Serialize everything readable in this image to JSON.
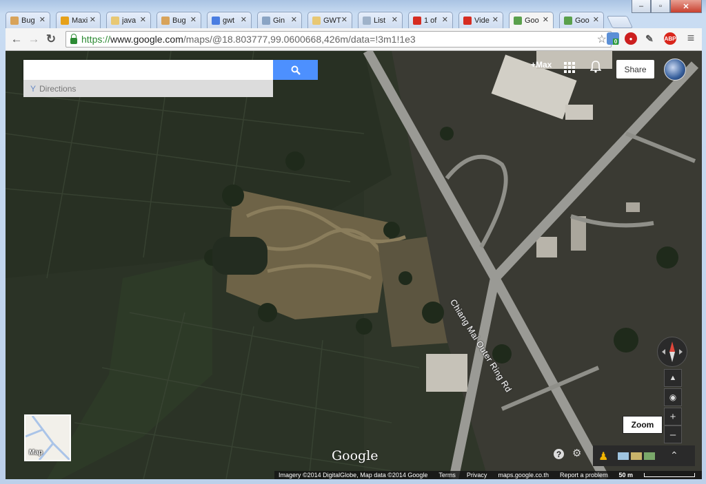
{
  "window": {
    "minimize": "–",
    "maximize": "▫",
    "close": "✕"
  },
  "tabs": [
    {
      "label": "Bug",
      "icon": "bug-favicon",
      "color": "#d8a35a",
      "active": false
    },
    {
      "label": "Maxi",
      "icon": "maxi-favicon",
      "color": "#e6a11a",
      "active": false
    },
    {
      "label": "java",
      "icon": "doc-favicon",
      "color": "#e8c874",
      "active": false
    },
    {
      "label": "Bug",
      "icon": "bug-favicon",
      "color": "#d8a35a",
      "active": false
    },
    {
      "label": "gwt",
      "icon": "google-favicon",
      "color": "#4a7de1",
      "active": false
    },
    {
      "label": "Gin",
      "icon": "gin-favicon",
      "color": "#8aa4c4",
      "active": false
    },
    {
      "label": "GWT",
      "icon": "doc-favicon",
      "color": "#e8c874",
      "active": false
    },
    {
      "label": "List",
      "icon": "loading-favicon",
      "color": "#9fb2c9",
      "active": false
    },
    {
      "label": "1 of",
      "icon": "youtube-favicon",
      "color": "#d62c21",
      "active": false
    },
    {
      "label": "Vide",
      "icon": "youtube-favicon",
      "color": "#d62c21",
      "active": false
    },
    {
      "label": "Goo",
      "icon": "maps-favicon",
      "color": "#5aa04c",
      "active": true
    },
    {
      "label": "Goo",
      "icon": "maps-favicon",
      "color": "#5aa04c",
      "active": false
    }
  ],
  "tab_close": "✕",
  "address": {
    "scheme": "https://",
    "host": "www.google.com",
    "path": "/maps/@18.803777,99.0600668,426m/data=!3m1!1e3"
  },
  "toolbar": {
    "back": "←",
    "forward": "→",
    "reload": "↻",
    "star": "☆",
    "menu": "≡",
    "extension_badge": "0",
    "abp": "ABP"
  },
  "map": {
    "search_placeholder": "",
    "directions_label": "Directions",
    "plus_max": "+Max",
    "share": "Share",
    "road_name": "Chiang Mai Outer Ring Rd",
    "zoom_tooltip": "Zoom",
    "minimap_label": "Map",
    "logo": "Google",
    "zoom_in": "+",
    "zoom_out": "–",
    "help": "?",
    "settings": "⚙",
    "expand": "⌃"
  },
  "footer": {
    "imagery": "Imagery ©2014 DigitalGlobe, Map data ©2014 Google",
    "terms": "Terms",
    "privacy": "Privacy",
    "maps_link": "maps.google.co.th",
    "report": "Report a problem",
    "scale": "50 m"
  }
}
